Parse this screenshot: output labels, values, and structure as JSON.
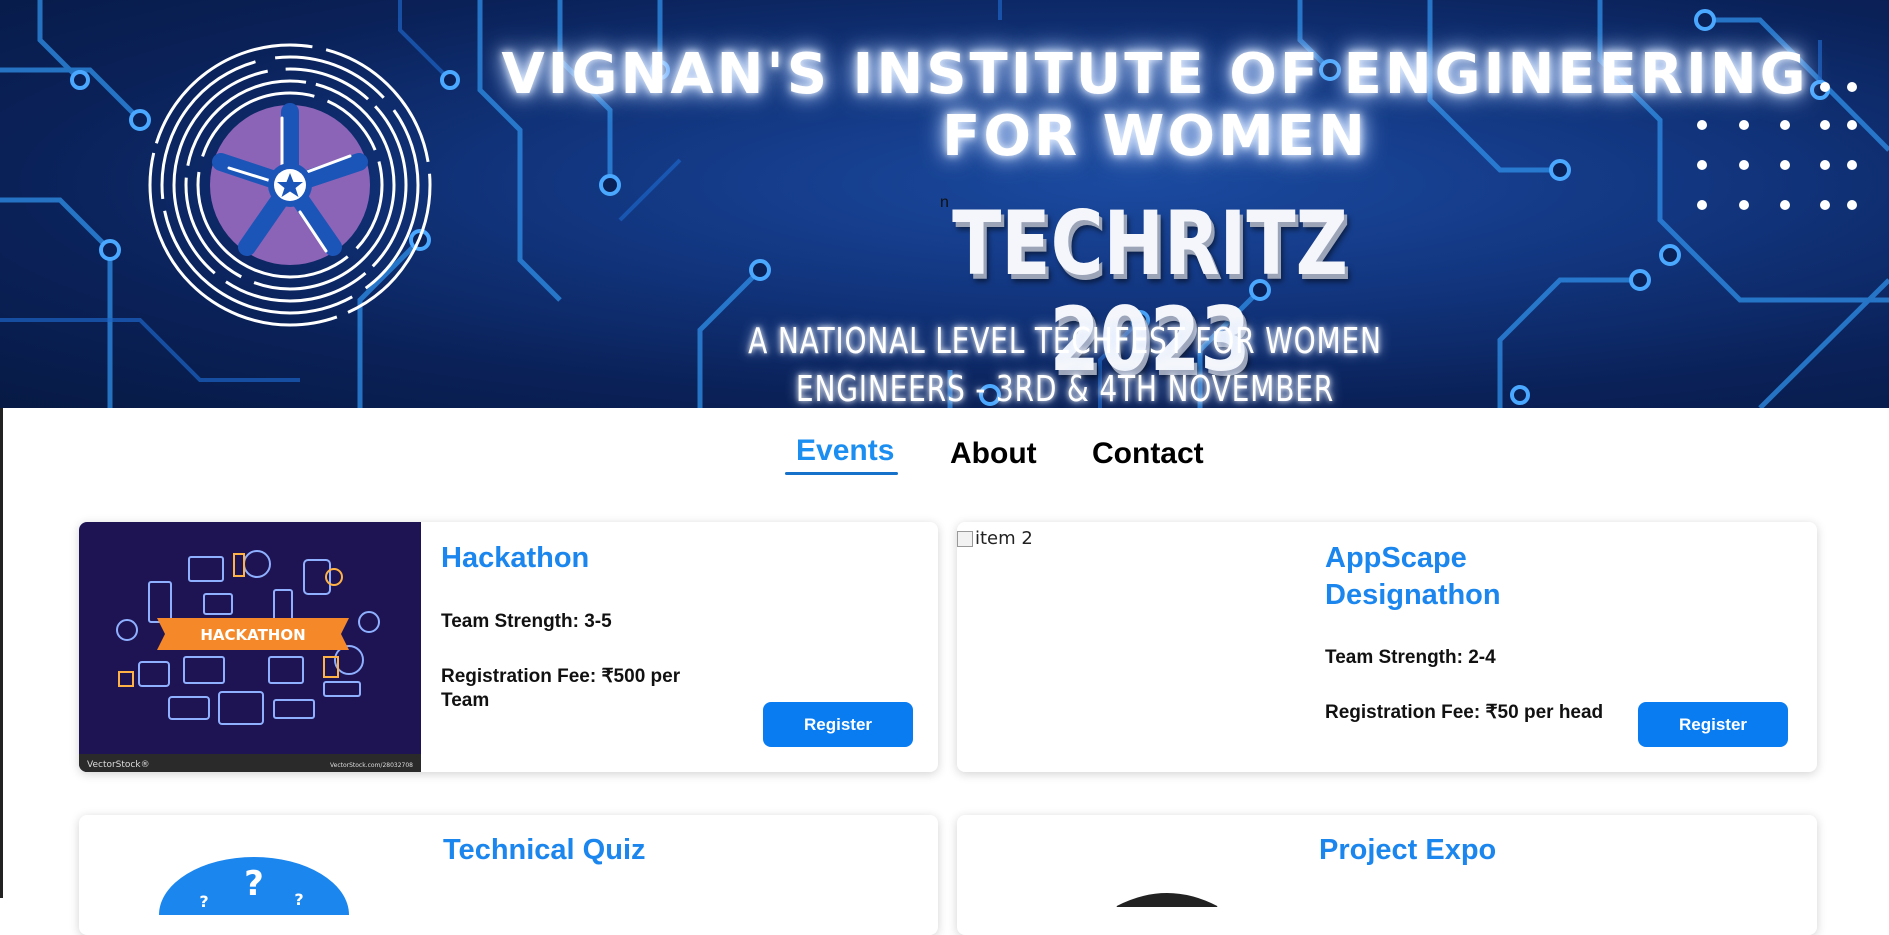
{
  "banner": {
    "institute_title": "VIGNAN'S INSTITUTE OF ENGINEERING FOR WOMEN",
    "fest_title": "TECHRITZ 2023",
    "fest_subtitle": "A NATIONAL LEVEL TECHFEST FOR WOMEN ENGINEERS - 3RD & 4TH NOVEMBER",
    "stray_text": "n",
    "logo_icon": "techritz-logo-icon"
  },
  "nav": {
    "items": [
      {
        "label": "Events",
        "active": true
      },
      {
        "label": "About",
        "active": false
      },
      {
        "label": "Contact",
        "active": false
      }
    ]
  },
  "colors": {
    "accent": "#1b86ee",
    "button": "#0a7cf2",
    "banner_bg": "#0a2158"
  },
  "events": [
    {
      "title": "Hackathon",
      "team_strength": "Team Strength: 3-5",
      "fee": "Registration Fee: ₹500 per Team",
      "button": "Register",
      "image_caption": "HACKATHON",
      "image_credit_left": "VectorStock®",
      "image_credit_right": "VectorStock.com/28032708"
    },
    {
      "title": "AppScape Designathon",
      "team_strength": "Team Strength: 2-4",
      "fee": "Registration Fee: ₹50 per head",
      "button": "Register",
      "image_alt": "item 2"
    },
    {
      "title": "Technical Quiz"
    },
    {
      "title": "Project Expo"
    }
  ]
}
